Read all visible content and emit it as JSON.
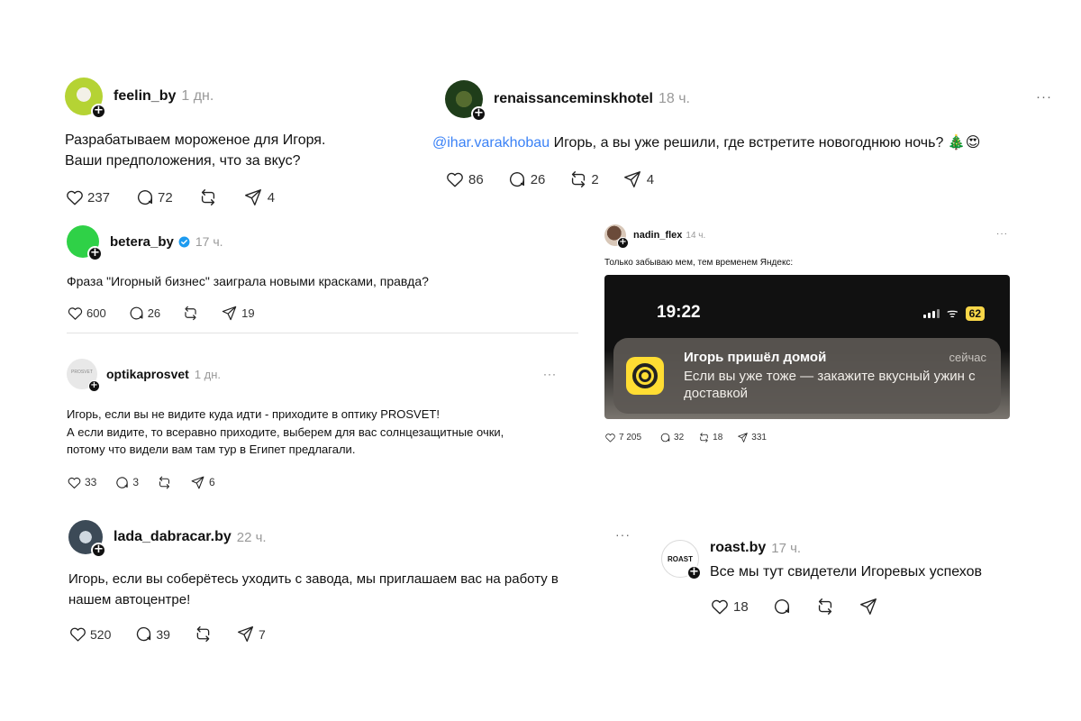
{
  "posts": [
    {
      "username": "feelin_by",
      "time": "1 дн.",
      "lines": [
        "Разрабатываем мороженое для Игоря.",
        "Ваши предположения, что за вкус?"
      ],
      "likes": "237",
      "comments": "72",
      "reposts": "",
      "shares": "4"
    },
    {
      "username": "renaissanceminskhotel",
      "time": "18 ч.",
      "mention": "@ihar.varakhobau",
      "text": "Игорь, а вы уже решили, где встретите новогоднюю ночь? 🎄😍",
      "likes": "86",
      "comments": "26",
      "reposts": "2",
      "shares": "4",
      "more": "···"
    },
    {
      "username": "betera_by",
      "verified": true,
      "time": "17 ч.",
      "text": "Фраза \"Игорный бизнес\" заиграла новыми красками, правда?",
      "likes": "600",
      "comments": "26",
      "reposts": "",
      "shares": "19"
    },
    {
      "username": "optikaprosvet",
      "avatar_text": "PROSVET",
      "time": "1 дн.",
      "lines": [
        "Игорь, если вы не видите куда идти - приходите в оптику PROSVET!",
        "А если видите, то всеравно приходите, выберем для вас солнцезащитные очки,",
        "потому что видели вам там тур в Египет предлагали."
      ],
      "likes": "33",
      "comments": "3",
      "reposts": "",
      "shares": "6",
      "more": "···"
    },
    {
      "username": "lada_dabracar.by",
      "time": "22 ч.",
      "lines": [
        "Игорь, если вы соберётесь уходить с завода, мы приглашаем вас на работу в",
        "нашем автоцентре!"
      ],
      "likes": "520",
      "comments": "39",
      "reposts": "",
      "shares": "7",
      "more": "···"
    },
    {
      "username": "nadin_flex",
      "time": "14 ч.",
      "text": "Только забываю мем, тем временем Яндекс:",
      "phone": {
        "clock": "19:22",
        "battery": "62",
        "notification_title": "Игорь пришёл домой",
        "notification_time": "сейчас",
        "notification_body": "Если вы уже тоже — закажите вкусный ужин с доставкой"
      },
      "likes": "7 205",
      "comments": "32",
      "reposts": "18",
      "shares": "331",
      "more": "···"
    },
    {
      "username": "roast.by",
      "avatar_text": "ROAST",
      "time": "17 ч.",
      "text": "Все мы тут свидетели Игоревых успехов",
      "likes": "18",
      "comments": "",
      "reposts": "",
      "shares": ""
    }
  ]
}
